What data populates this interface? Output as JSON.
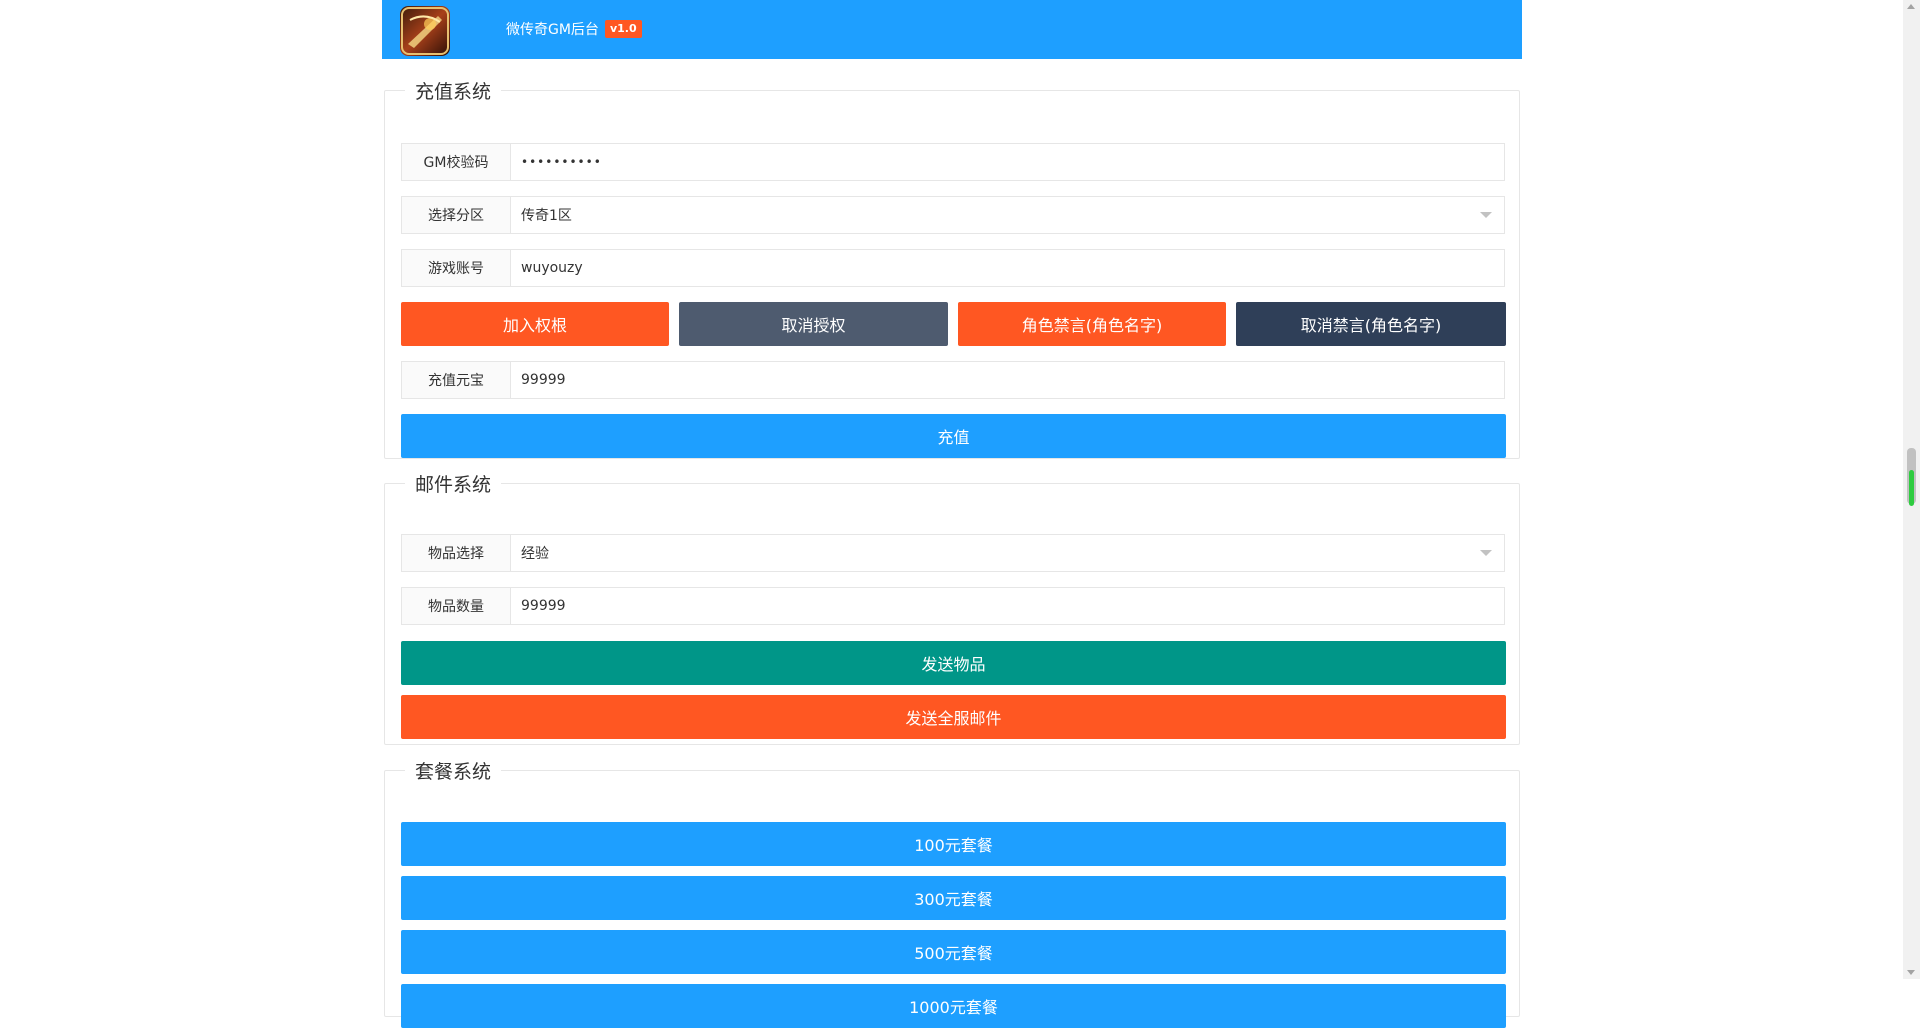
{
  "header": {
    "title": "微传奇GM后台",
    "version": "v1.0",
    "bg_color": "#1e9fff"
  },
  "recharge": {
    "legend": "充值系统",
    "gm_code_label": "GM校验码",
    "gm_code_value": "••••••••••",
    "server_label": "选择分区",
    "server_value": "传奇1区",
    "account_label": "游戏账号",
    "account_value": "wuyouzy",
    "btn_add_auth": "加入权根",
    "btn_cancel_auth": "取消授权",
    "btn_ban": "角色禁言(角色名字)",
    "btn_unban": "取消禁言(角色名字)",
    "amount_label": "充值元宝",
    "amount_value": "99999",
    "btn_recharge": "充值"
  },
  "mail": {
    "legend": "邮件系统",
    "item_label": "物品选择",
    "item_value": "经验",
    "qty_label": "物品数量",
    "qty_value": "99999",
    "btn_send_item": "发送物品",
    "btn_send_all": "发送全服邮件"
  },
  "packages": {
    "legend": "套餐系统",
    "items": [
      "100元套餐",
      "300元套餐",
      "500元套餐",
      "1000元套餐"
    ]
  },
  "colors": {
    "primary": "#1e9fff",
    "danger": "#ff5722",
    "teal": "#009688",
    "slate": "#4e5b6f",
    "navy": "#2f3f58"
  }
}
